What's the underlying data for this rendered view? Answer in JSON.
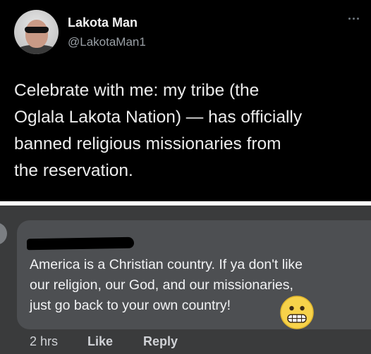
{
  "tweet": {
    "display_name": "Lakota Man",
    "handle": "@LakotaMan1",
    "text_lines": [
      "Celebrate with me: my tribe (the",
      "Oglala Lakota Nation) — has officially",
      "banned religious missionaries from",
      "the reservation."
    ],
    "avatar_icon": "profile-photo",
    "more_icon": "more-options-icon"
  },
  "comment": {
    "text_lines": [
      "America is a Christian country. If ya don't like",
      "our religion, our God, and our missionaries,",
      "just go back to your own country!"
    ],
    "emoji_icon": "grimacing-face-icon",
    "time": "2 hrs",
    "like_label": "Like",
    "reply_label": "Reply"
  },
  "colors": {
    "tweet_background": "#000000",
    "comment_background": "#3a3b3c",
    "bubble_background": "#4d4f52",
    "emoji_yellow": "#f7d24a"
  }
}
